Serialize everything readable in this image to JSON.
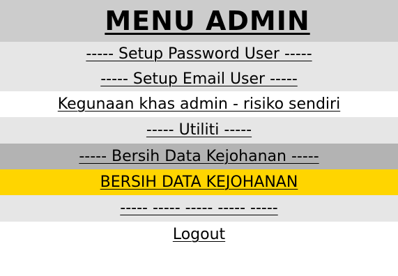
{
  "menu": {
    "title": "MENU ADMIN",
    "items": [
      {
        "label": "----- Setup Password User -----"
      },
      {
        "label": "----- Setup Email User -----"
      },
      {
        "label": "Kegunaan khas admin - risiko sendiri"
      },
      {
        "label": "----- Utiliti -----"
      },
      {
        "label": "----- Bersih Data Kejohanan -----"
      },
      {
        "label": "BERSIH DATA KEJOHANAN"
      },
      {
        "label": "----- ----- ----- ----- -----"
      },
      {
        "label": "Logout"
      }
    ]
  },
  "colors": {
    "title_bg": "#cccccc",
    "light_bg": "#e6e6e6",
    "section_bg": "#b3b3b3",
    "highlight_bg": "#ffd500"
  }
}
